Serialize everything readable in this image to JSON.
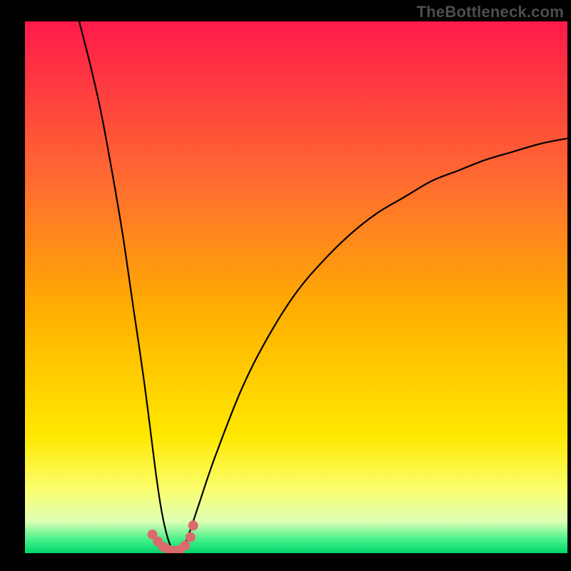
{
  "watermark": "TheBottleneck.com",
  "chart_data": {
    "type": "line",
    "title": "",
    "xlabel": "",
    "ylabel": "",
    "xlim": [
      0,
      100
    ],
    "ylim": [
      0,
      100
    ],
    "grid": false,
    "background_gradient": [
      {
        "pos": 0.0,
        "color": "#ff1a4b"
      },
      {
        "pos": 0.3,
        "color": "#ff6b30"
      },
      {
        "pos": 0.55,
        "color": "#ffb000"
      },
      {
        "pos": 0.78,
        "color": "#ffe800"
      },
      {
        "pos": 0.88,
        "color": "#fbff6e"
      },
      {
        "pos": 0.94,
        "color": "#dfffb5"
      },
      {
        "pos": 0.975,
        "color": "#45f08a"
      },
      {
        "pos": 1.0,
        "color": "#00d56b"
      }
    ],
    "series": [
      {
        "name": "bottleneck-curve",
        "type": "line",
        "color": "#000000",
        "x": [
          10,
          12,
          14,
          16,
          18,
          20,
          22,
          24,
          25,
          26,
          27,
          28,
          29,
          30,
          32,
          35,
          40,
          45,
          50,
          55,
          60,
          65,
          70,
          75,
          80,
          85,
          90,
          95,
          100
        ],
        "y": [
          100,
          92,
          83,
          72,
          60,
          46,
          32,
          16,
          9,
          4,
          1,
          0,
          1,
          3,
          9,
          18,
          31,
          41,
          49,
          55,
          60,
          64,
          67,
          70,
          72,
          74,
          75.5,
          77,
          78
        ]
      },
      {
        "name": "sweet-spot-markers",
        "type": "scatter",
        "color": "#db6b6b",
        "x": [
          23.5,
          24.5,
          25.5,
          26.5,
          27.5,
          28.5,
          29.5,
          30.5,
          31.0
        ],
        "y": [
          3.5,
          2.2,
          1.2,
          0.6,
          0.4,
          0.6,
          1.4,
          3.0,
          5.2
        ]
      }
    ]
  }
}
